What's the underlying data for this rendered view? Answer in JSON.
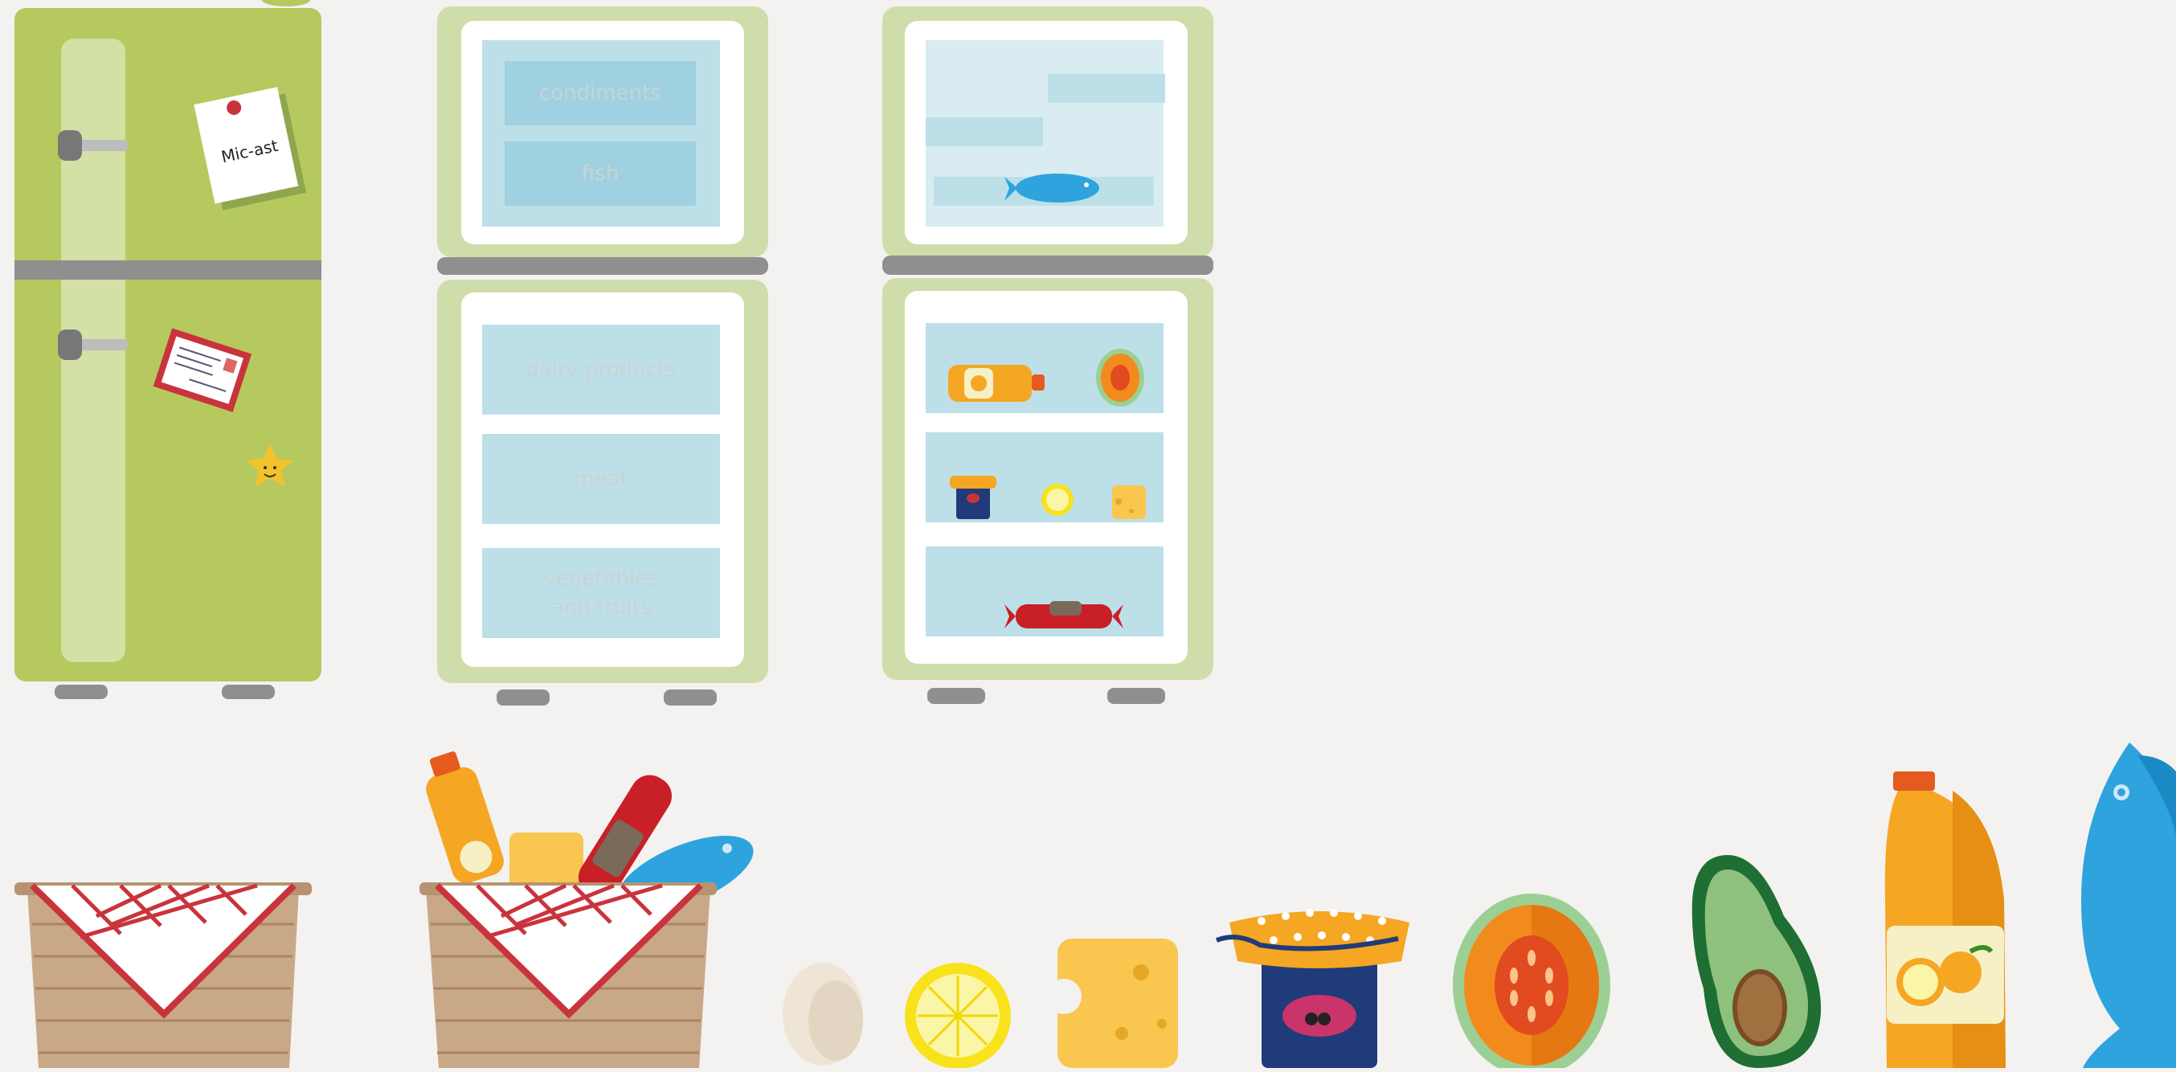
{
  "game": {
    "note_text": "Mic-ast",
    "shelves_left_freezer": [
      "condiments",
      "fish"
    ],
    "shelves_left_fridge": [
      "dairy products",
      "meat",
      "vegetables and fruits"
    ],
    "shelf_label_vegetables_lines": [
      "vegetables",
      "and fruits"
    ]
  },
  "colors": {
    "background": "#f3f2f0",
    "fridge_green": "#b5c95f",
    "fridge_frame": "#cfddaa",
    "shelf_blue": "#9fd1e0",
    "shelf_light": "#bde0e8",
    "inner_light": "#d8ecf1",
    "divider_gray": "#8f8f8f",
    "basket_tan": "#c9a887",
    "cloth_red": "#c9343c",
    "fish_blue": "#2ea3de",
    "juice_orange": "#f5a623",
    "jam_navy": "#1f3b7a"
  },
  "icons": [
    "fridge-closed",
    "fridge-open-labeled",
    "fridge-open-filled",
    "basket-empty",
    "basket-full",
    "egg-icon",
    "lemon-icon",
    "cheese-icon",
    "jam-jar-icon",
    "melon-icon",
    "avocado-icon",
    "juice-bottle-icon",
    "fish-icon",
    "sticky-note-icon",
    "postcard-icon",
    "star-magnet-icon",
    "sausage-icon"
  ]
}
